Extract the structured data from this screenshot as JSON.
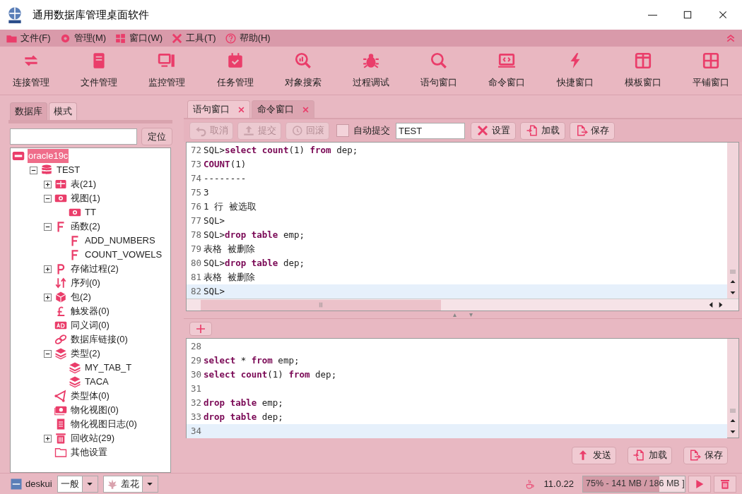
{
  "window": {
    "title": "通用数据库管理桌面软件"
  },
  "menu": [
    {
      "label": "文件(F)"
    },
    {
      "label": "管理(M)"
    },
    {
      "label": "窗口(W)"
    },
    {
      "label": "工具(T)"
    },
    {
      "label": "帮助(H)"
    }
  ],
  "toolbar": [
    "连接管理",
    "文件管理",
    "监控管理",
    "任务管理",
    "对象搜索",
    "过程调试",
    "语句窗口",
    "命令窗口",
    "快捷窗口",
    "模板窗口",
    "平铺窗口"
  ],
  "left_tabs": [
    {
      "label": "数据库",
      "selected": true
    },
    {
      "label": "模式",
      "selected": false
    }
  ],
  "locate_button": "定位",
  "tree": [
    {
      "label": "oracle19c",
      "kind": "server",
      "selected": true,
      "children": [
        {
          "label": "TEST",
          "kind": "database",
          "expanded": true,
          "children": [
            {
              "label": "表(21)",
              "kind": "table",
              "expanded": false
            },
            {
              "label": "视图(1)",
              "kind": "view",
              "expanded": true,
              "children": [
                {
                  "label": "TT",
                  "kind": "view"
                }
              ]
            },
            {
              "label": "函数(2)",
              "kind": "function",
              "expanded": true,
              "children": [
                {
                  "label": "ADD_NUMBERS",
                  "kind": "function"
                },
                {
                  "label": "COUNT_VOWELS",
                  "kind": "function"
                }
              ]
            },
            {
              "label": "存储过程(2)",
              "kind": "procedure",
              "expanded": false
            },
            {
              "label": "序列(0)",
              "kind": "sequence"
            },
            {
              "label": "包(2)",
              "kind": "package",
              "expanded": false
            },
            {
              "label": "触发器(0)",
              "kind": "trigger"
            },
            {
              "label": "同义词(0)",
              "kind": "synonym"
            },
            {
              "label": "数据库链接(0)",
              "kind": "dblink"
            },
            {
              "label": "类型(2)",
              "kind": "type",
              "expanded": true,
              "children": [
                {
                  "label": "MY_TAB_T",
                  "kind": "type"
                },
                {
                  "label": "TACA",
                  "kind": "type"
                }
              ]
            },
            {
              "label": "类型体(0)",
              "kind": "typebody"
            },
            {
              "label": "物化视图(0)",
              "kind": "mview"
            },
            {
              "label": "物化视图日志(0)",
              "kind": "mviewlog"
            },
            {
              "label": "回收站(29)",
              "kind": "recycle",
              "expanded": false
            },
            {
              "label": "其他设置",
              "kind": "folder"
            }
          ]
        }
      ]
    }
  ],
  "editor_tabs": [
    {
      "label": "语句窗口",
      "selected": false
    },
    {
      "label": "命令窗口",
      "selected": true
    }
  ],
  "command_toolbar": {
    "buttons": [
      {
        "label": "取消",
        "disabled": true
      },
      {
        "label": "提交",
        "disabled": true
      },
      {
        "label": "回滚",
        "disabled": true
      }
    ],
    "autocommit": {
      "label": "自动提交",
      "checked": false
    },
    "schema": "TEST",
    "actions": [
      "设置",
      "加载",
      "保存"
    ]
  },
  "output_lines": [
    {
      "n": "72",
      "text": "SQL>**select count**(1) **from** dep;"
    },
    {
      "n": "73",
      "text": "**COUNT**(1)"
    },
    {
      "n": "74",
      "text": "--------"
    },
    {
      "n": "75",
      "text": "3"
    },
    {
      "n": "76",
      "text": "1 行 被选取"
    },
    {
      "n": "77",
      "text": "SQL>"
    },
    {
      "n": "78",
      "text": "SQL>**drop table** emp;"
    },
    {
      "n": "79",
      "text": "表格 被删除"
    },
    {
      "n": "80",
      "text": "SQL>**drop table** dep;"
    },
    {
      "n": "81",
      "text": "表格 被删除"
    },
    {
      "n": "82",
      "text": "SQL>",
      "current": true
    }
  ],
  "input_lines": [
    {
      "n": "28"
    },
    {
      "n": "29",
      "text": "**select** * **from** emp;"
    },
    {
      "n": "30",
      "text": "**select count**(1) **from** dep;"
    },
    {
      "n": "31"
    },
    {
      "n": "32",
      "text": "**drop table** emp;"
    },
    {
      "n": "33",
      "text": "**drop table** dep;"
    },
    {
      "n": "34",
      "current": true
    }
  ],
  "bottom_buttons": [
    "发送",
    "加载",
    "保存"
  ],
  "status_bar": {
    "user": "deskui",
    "level": "一般",
    "theme": "羞花",
    "version": "11.0.22",
    "memory": {
      "text": "75% - 141 MB / 186 MB ]",
      "level": 0.75
    }
  }
}
